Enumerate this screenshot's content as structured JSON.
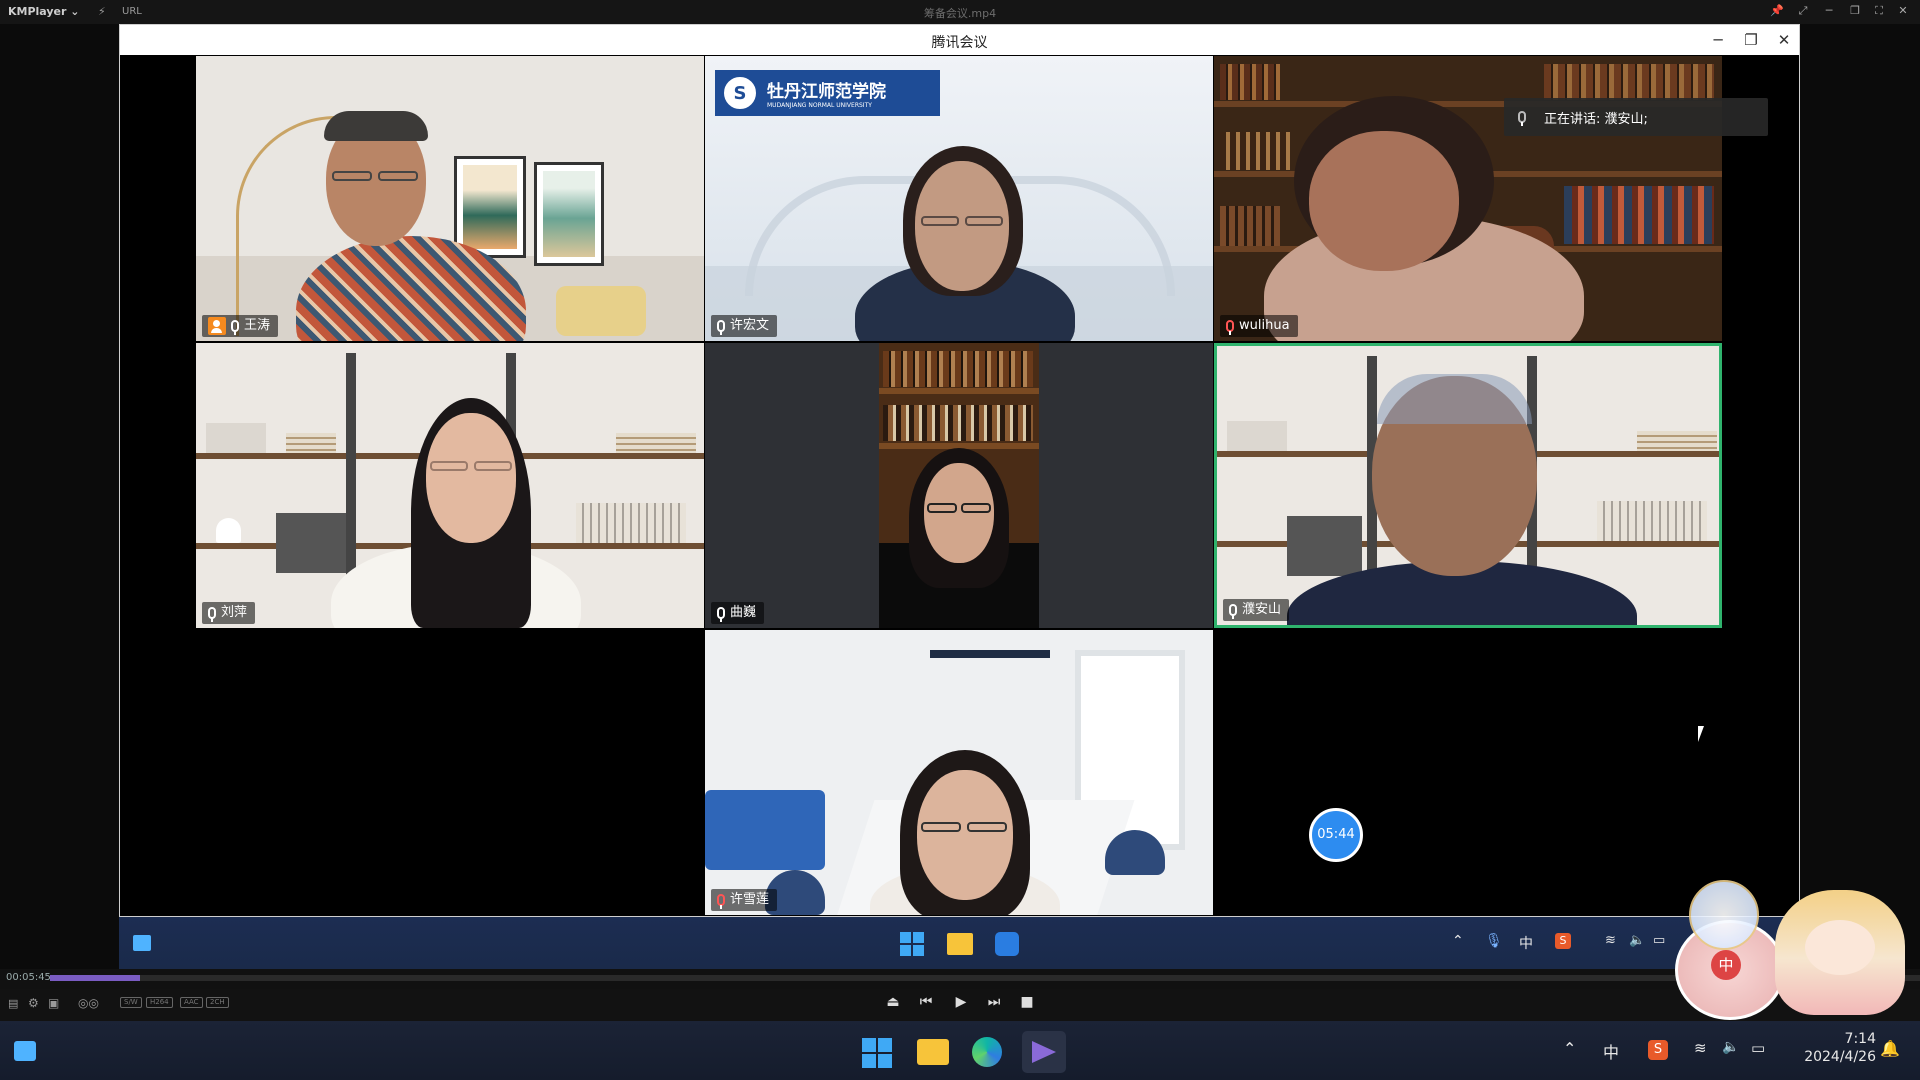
{
  "player": {
    "app_name": "KMPlayer",
    "app_menu_arrow": "⌄",
    "url_label": "URL",
    "file_name": "筹备会议.mp4",
    "elapsed": "00:05:45",
    "progress_fraction": 0.048,
    "codec_badges": [
      "S/W",
      "H264",
      "AAC",
      "2CH"
    ]
  },
  "meeting": {
    "window_title": "腾讯会议",
    "speaking_label": "正在讲话:  濮安山;",
    "timer": "05:44",
    "participants": [
      {
        "name": "王涛",
        "host": true
      },
      {
        "name": "许宏文"
      },
      {
        "name": "wulihua"
      },
      {
        "name": "刘萍"
      },
      {
        "name": "曲巍"
      },
      {
        "name": "濮安山",
        "active_speaker": true
      },
      {
        "name": "许雪莲"
      }
    ],
    "logo_text_cn": "牡丹江师范学院",
    "logo_text_en": "MUDANJIANG NORMAL UNIVERSITY"
  },
  "inner_taskbar": {
    "ime_label": "中"
  },
  "taskbar": {
    "ime_label": "中",
    "clock_time": "7:14",
    "clock_date": "2024/4/26"
  },
  "mascot": {
    "badge": "中"
  },
  "colors": {
    "active_speaker_border": "#2fb36d",
    "host_badge": "#f58a1f",
    "timer_bg": "#2d8cf0",
    "seek_fill": "#7a5cc2"
  }
}
